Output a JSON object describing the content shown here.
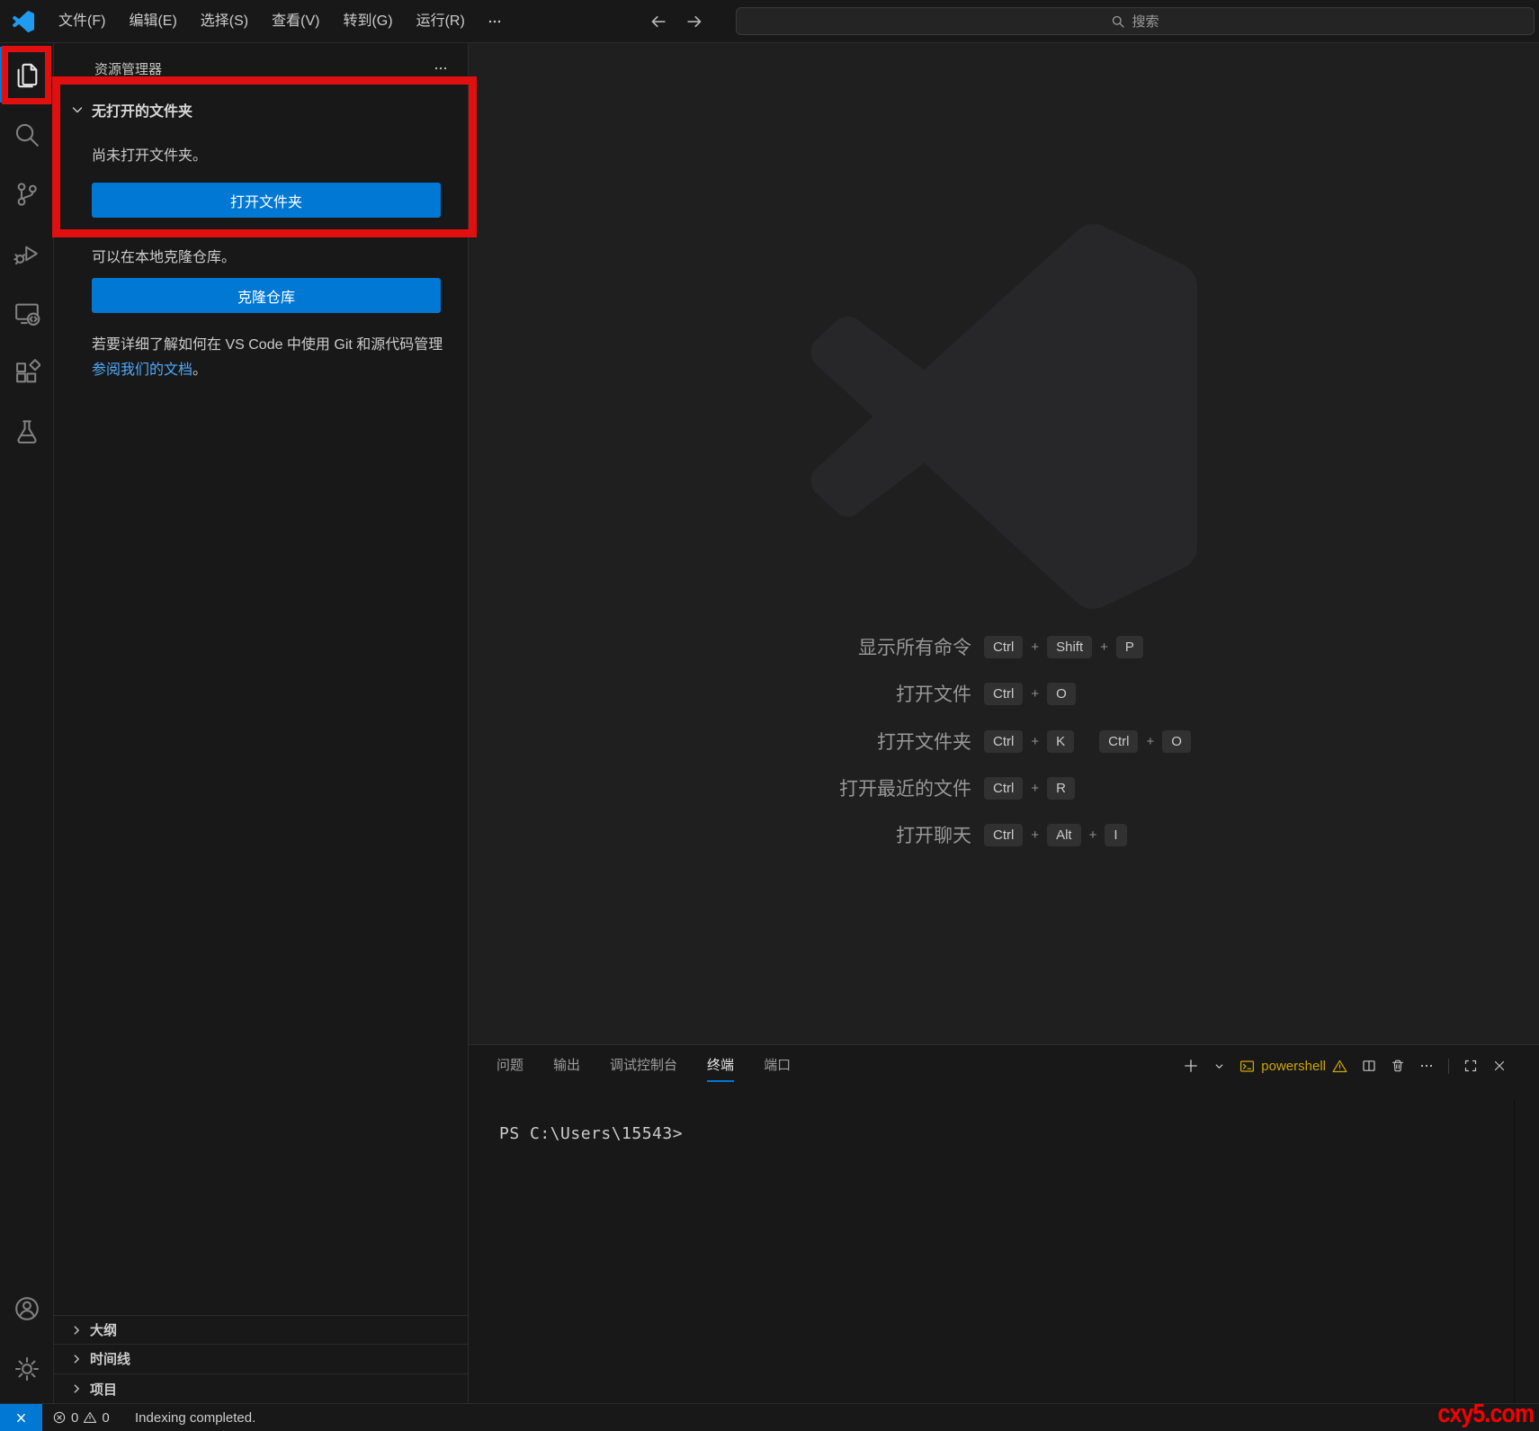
{
  "title_bar": {
    "menus": [
      "文件(F)",
      "编辑(E)",
      "选择(S)",
      "查看(V)",
      "转到(G)",
      "运行(R)"
    ],
    "search_placeholder": "搜索"
  },
  "sidebar": {
    "title": "资源管理器",
    "section_title": "无打开的文件夹",
    "empty_text": "尚未打开文件夹。",
    "open_folder_button": "打开文件夹",
    "clone_hint": "可以在本地克隆仓库。",
    "clone_button": "克隆仓库",
    "git_text": "若要详细了解如何在 VS Code 中使用 Git 和源代码管理",
    "git_link": "参阅我们的文档",
    "git_period": "。",
    "bottom_sections": [
      "大纲",
      "时间线",
      "项目"
    ]
  },
  "editor": {
    "plus": "+",
    "shortcuts": [
      {
        "label": "显示所有命令",
        "keys": [
          "Ctrl",
          "Shift",
          "P"
        ]
      },
      {
        "label": "打开文件",
        "keys": [
          "Ctrl",
          "O"
        ]
      },
      {
        "label": "打开文件夹",
        "keys": [
          "Ctrl",
          "K",
          "Ctrl",
          "O"
        ]
      },
      {
        "label": "打开最近的文件",
        "keys": [
          "Ctrl",
          "R"
        ]
      },
      {
        "label": "打开聊天",
        "keys": [
          "Ctrl",
          "Alt",
          "I"
        ]
      }
    ]
  },
  "panel": {
    "tabs": [
      "问题",
      "输出",
      "调试控制台",
      "终端",
      "端口"
    ],
    "active_tab": "终端",
    "terminal_profile": "powershell",
    "terminal_prompt": "PS C:\\Users\\15543>"
  },
  "status_bar": {
    "error_count": "0",
    "warning_count": "0",
    "message": "Indexing completed."
  },
  "watermark": "cxy5.com",
  "colors": {
    "accent_blue": "#0078d4",
    "chrome_bg": "#181818",
    "editor_bg": "#1f1f1f",
    "link_blue": "#4daafc",
    "terminal_warning_gold": "#cca700",
    "annotation_red": "#e01010",
    "watermark_red": "#f40000"
  },
  "icons": [
    "vscode-logo",
    "back-arrow",
    "forward-arrow",
    "search",
    "explorer-files",
    "source-control",
    "run-debug",
    "remote-explorer",
    "extensions",
    "testing-beaker",
    "account",
    "settings-gear",
    "more-ellipsis",
    "chevron-down",
    "chevron-right",
    "plus",
    "terminal",
    "warning",
    "split-editor",
    "trash",
    "maximize",
    "close",
    "remote-status",
    "error-circle"
  ]
}
